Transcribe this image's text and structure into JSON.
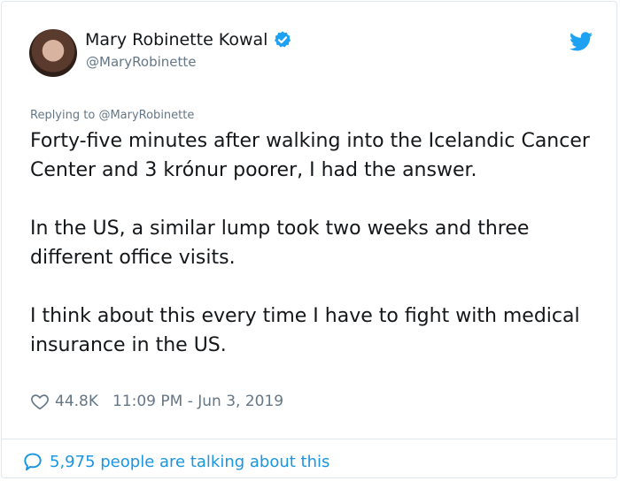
{
  "tweet": {
    "author_name": "Mary Robinette Kowal",
    "author_handle": "@MaryRobinette",
    "replying_prefix": "Replying to",
    "replying_handle": "@MaryRobinette",
    "paragraphs": [
      "Forty-five minutes after walking into the Icelandic Cancer Center and 3 krónur poorer, I had the answer.",
      "In the US, a similar lump took two weeks and three different office visits.",
      "I think about this every time I have to fight with medical insurance in the US."
    ],
    "likes": "44.8K",
    "timestamp": "11:09 PM - Jun 3, 2019",
    "talking_text": "5,975 people are talking about this"
  },
  "icons": {
    "verified": "verified-badge-icon",
    "platform": "twitter-bird-icon",
    "like": "heart-icon",
    "conversation": "speech-bubble-icon"
  },
  "colors": {
    "accent": "#1da1f2",
    "link": "#1b95e0",
    "text": "#14171a",
    "muted": "#657786",
    "border": "#e1e8ed"
  }
}
